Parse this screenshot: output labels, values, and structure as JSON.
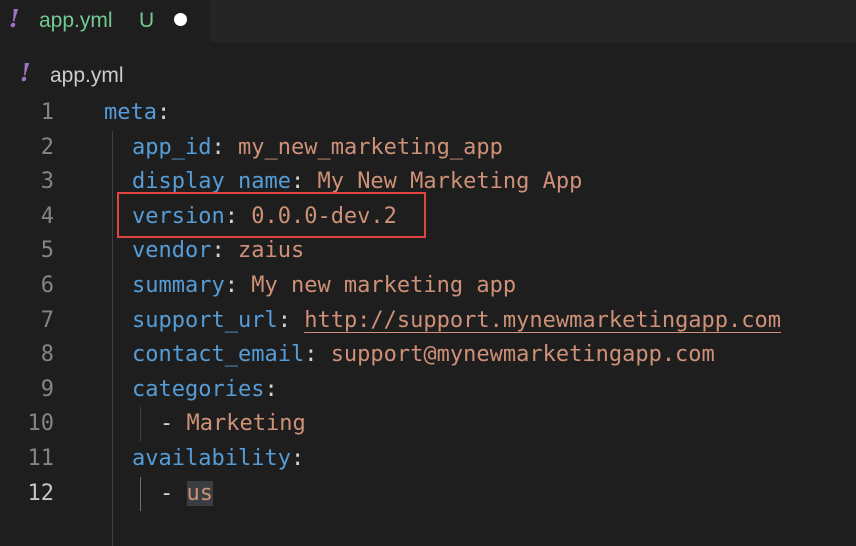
{
  "tab": {
    "icon": "yaml-exclamation-icon",
    "icon_glyph": "!",
    "name": "app.yml",
    "status": "U"
  },
  "breadcrumb": {
    "icon_glyph": "!",
    "label": "app.yml"
  },
  "editor": {
    "lines": [
      {
        "num": "1",
        "indent": 0,
        "key": "meta",
        "sep": ":",
        "value": ""
      },
      {
        "num": "2",
        "indent": 1,
        "key": "app_id",
        "sep": ": ",
        "value": "my_new_marketing_app"
      },
      {
        "num": "3",
        "indent": 1,
        "key": "display_name",
        "sep": ": ",
        "value": "My New Marketing App"
      },
      {
        "num": "4",
        "indent": 1,
        "key": "version",
        "sep": ": ",
        "value": "0.0.0-dev.2"
      },
      {
        "num": "5",
        "indent": 1,
        "key": "vendor",
        "sep": ": ",
        "value": "zaius"
      },
      {
        "num": "6",
        "indent": 1,
        "key": "summary",
        "sep": ": ",
        "value": "My new marketing app"
      },
      {
        "num": "7",
        "indent": 1,
        "key": "support_url",
        "sep": ": ",
        "value": "http://support.mynewmarketingapp.com"
      },
      {
        "num": "8",
        "indent": 1,
        "key": "contact_email",
        "sep": ": ",
        "value": "support@mynewmarketingapp.com"
      },
      {
        "num": "9",
        "indent": 1,
        "key": "categories",
        "sep": ":",
        "value": ""
      },
      {
        "num": "10",
        "indent": 2,
        "dash": "- ",
        "value": "Marketing"
      },
      {
        "num": "11",
        "indent": 1,
        "key": "availability",
        "sep": ":",
        "value": ""
      },
      {
        "num": "12",
        "indent": 2,
        "dash": "- ",
        "value": "us"
      }
    ]
  },
  "colors": {
    "key": "#569cd6",
    "string": "#ce9178",
    "tab_modified": "#73c991",
    "yaml_icon": "#a074c4",
    "highlight_box": "#e0443e"
  }
}
